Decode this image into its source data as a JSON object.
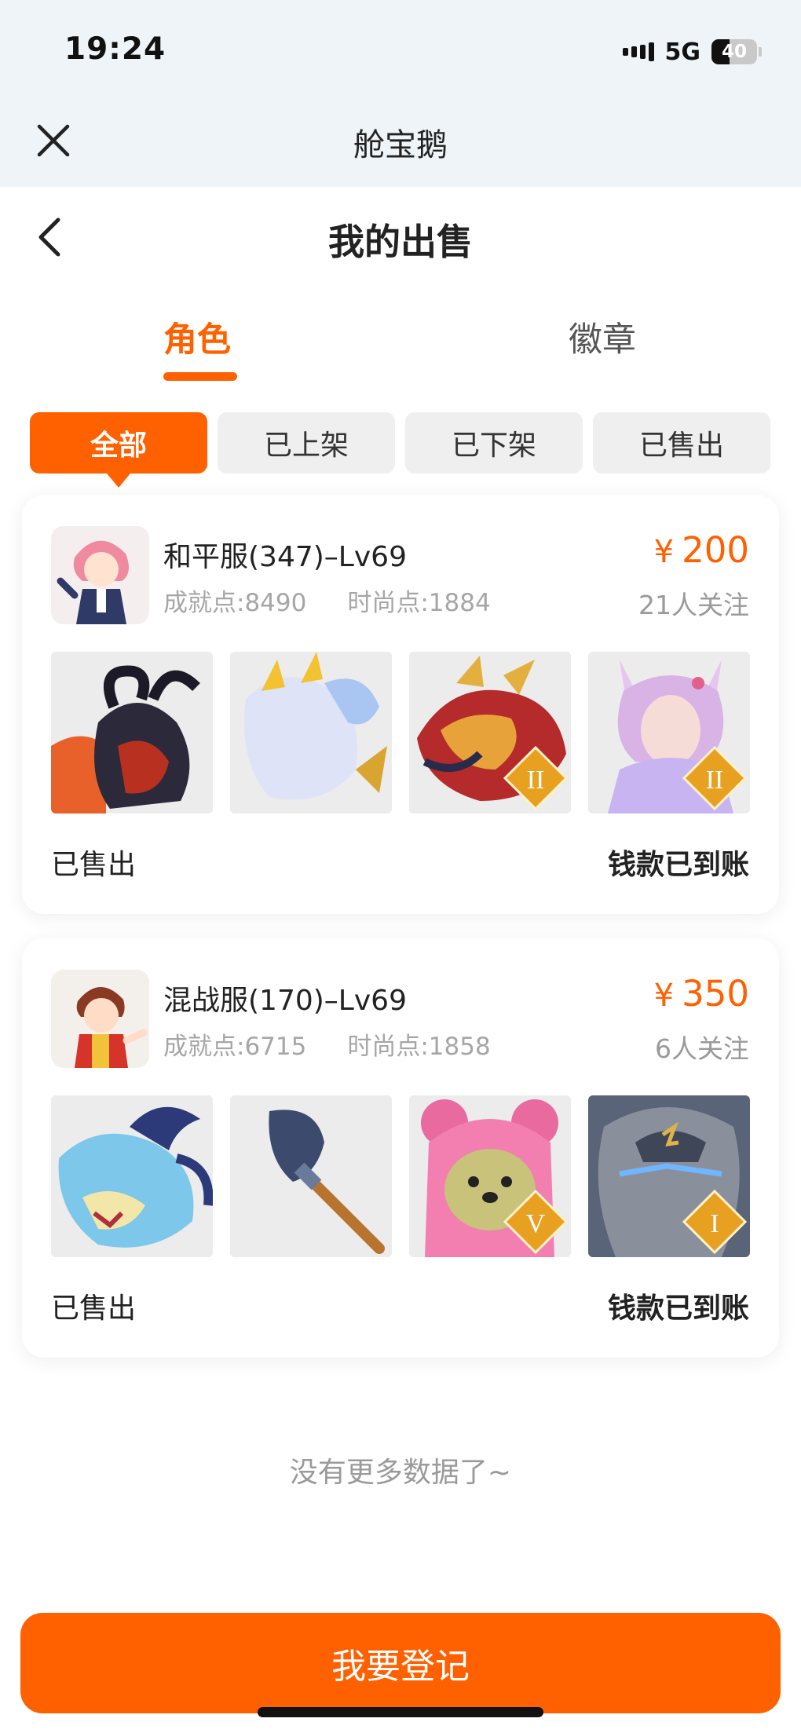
{
  "status_bar": {
    "time": "19:24",
    "network": "5G",
    "battery": "40",
    "battery_level": 0.4
  },
  "app_header": {
    "title": "舱宝鹅"
  },
  "page_header": {
    "title": "我的出售"
  },
  "tabs": [
    {
      "label": "角色",
      "active": true
    },
    {
      "label": "徽章",
      "active": false
    }
  ],
  "filters": [
    {
      "label": "全部",
      "active": true
    },
    {
      "label": "已上架",
      "active": false
    },
    {
      "label": "已下架",
      "active": false
    },
    {
      "label": "已售出",
      "active": false
    }
  ],
  "listings": [
    {
      "server": "和平服(347)–Lv69",
      "achievement": "成就点:8490",
      "fashion": "时尚点:1884",
      "currency": "¥",
      "price": "200",
      "followers": "21人关注",
      "items": [
        {
          "icon": "dark-ram-mount-icon",
          "tier": ""
        },
        {
          "icon": "ice-horse-mount-icon",
          "tier": ""
        },
        {
          "icon": "red-dragon-mount-icon",
          "tier": "II"
        },
        {
          "icon": "fox-spirit-pet-icon",
          "tier": "II"
        }
      ],
      "status": "已售出",
      "payment_status": "钱款已到账"
    },
    {
      "server": "混战服(170)–Lv69",
      "achievement": "成就点:6715",
      "fashion": "时尚点:1858",
      "currency": "¥",
      "price": "350",
      "followers": "6人关注",
      "items": [
        {
          "icon": "blue-dragon-mount-icon",
          "tier": ""
        },
        {
          "icon": "shovel-icon",
          "tier": ""
        },
        {
          "icon": "pink-bear-pet-icon",
          "tier": "V"
        },
        {
          "icon": "rock-golem-pet-icon",
          "tier": "I"
        }
      ],
      "status": "已售出",
      "payment_status": "钱款已到账"
    }
  ],
  "footer_note": "没有更多数据了~",
  "register_button": "我要登记",
  "colors": {
    "accent": "#ff6000",
    "header_bg": "#eef4f7",
    "chip_bg": "#efefef"
  }
}
